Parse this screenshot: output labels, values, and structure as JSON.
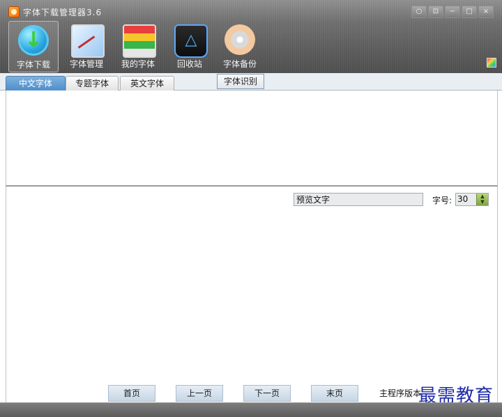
{
  "app": {
    "title": "字体下载管理器3.6"
  },
  "window_controls": [
    "○",
    "⊡",
    "−",
    "□",
    "×"
  ],
  "toolbar": [
    {
      "label": "字体下载",
      "icon": "download-icon",
      "active": true
    },
    {
      "label": "字体管理",
      "icon": "font-manage-icon",
      "active": false
    },
    {
      "label": "我的字体",
      "icon": "my-fonts-icon",
      "active": false
    },
    {
      "label": "回收站",
      "icon": "recycle-bin-icon",
      "active": false
    },
    {
      "label": "字体备份",
      "icon": "backup-disc-icon",
      "active": false
    }
  ],
  "tabs": [
    {
      "label": "中文字体",
      "active": true
    },
    {
      "label": "专题字体",
      "active": false
    },
    {
      "label": "英文字体",
      "active": false
    }
  ],
  "recognize_button": "字体识别",
  "preview": {
    "value": "预览文字",
    "size_label": "字号:",
    "size_value": "30"
  },
  "pager": {
    "first": "首页",
    "prev": "上一页",
    "next": "下一页",
    "last": "末页"
  },
  "version_label": "主程序版本",
  "watermark": "最需教育",
  "colors": {
    "active_tab": "#4f8ec9",
    "spinner": "#7da53e",
    "watermark": "#1f2ba8"
  }
}
